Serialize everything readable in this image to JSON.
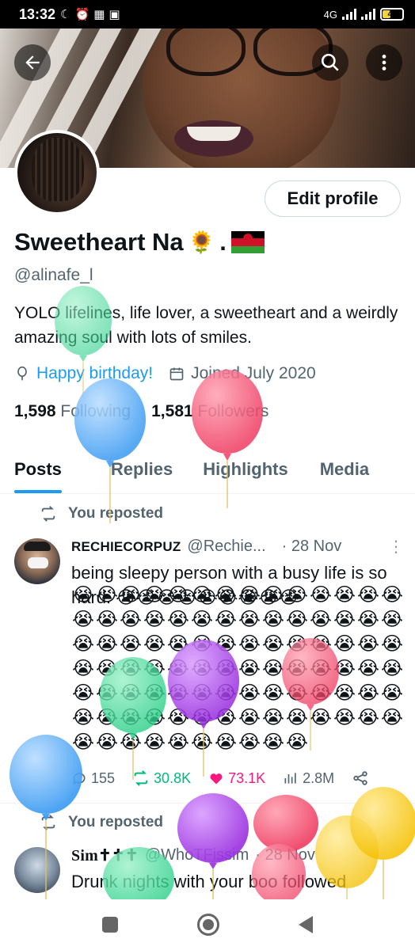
{
  "status_bar": {
    "time": "13:32",
    "network": "4G",
    "battery": "49"
  },
  "profile": {
    "display_name": "Sweetheart Na",
    "name_emoji": "🌻",
    "name_dot": ".",
    "handle": "@alinafe_l",
    "bio": "YOLO lifelines, life lover, a sweetheart and a weirdly amazing soul with lots of smiles.",
    "birthday_text": "Happy birthday!",
    "joined_text": "Joined July 2020",
    "following_count": "1,598",
    "following_label": "Following",
    "followers_count": "1,581",
    "followers_label": "Followers",
    "edit_label": "Edit profile"
  },
  "tabs": [
    {
      "label": "Posts"
    },
    {
      "label": "Replies"
    },
    {
      "label": "Highlights"
    },
    {
      "label": "Media"
    }
  ],
  "posts": [
    {
      "repost_label": "You reposted",
      "author": "RECHIECORPUZ",
      "handle": "@Rechie...",
      "time": "· 28 Nov",
      "text": "being sleepy person with a busy life is so hard.",
      "emoji": "😭",
      "replies": "155",
      "reposts": "30.8K",
      "likes": "73.1K",
      "views": "2.8M"
    },
    {
      "repost_label": "You reposted",
      "author": "Sim✝✝✝",
      "handle": "@WhoTFissim",
      "time": "· 28 Nov",
      "text": "Drunk nights with your boo followed"
    }
  ],
  "colors": {
    "accent": "#1d9bf0",
    "repost_green": "#00ba7c",
    "like_pink": "#f91880",
    "muted_text": "#536471",
    "flag_black": "#000000",
    "flag_red": "#ce1126",
    "flag_green": "#339e35"
  },
  "icons": {
    "back": "arrow-left",
    "search": "magnifier",
    "more": "vertical-dots",
    "birthday": "balloon",
    "calendar": "calendar",
    "repost": "repost-arrows",
    "reply": "speech-bubble",
    "like": "heart",
    "views": "bar-chart",
    "share": "share-nodes"
  }
}
